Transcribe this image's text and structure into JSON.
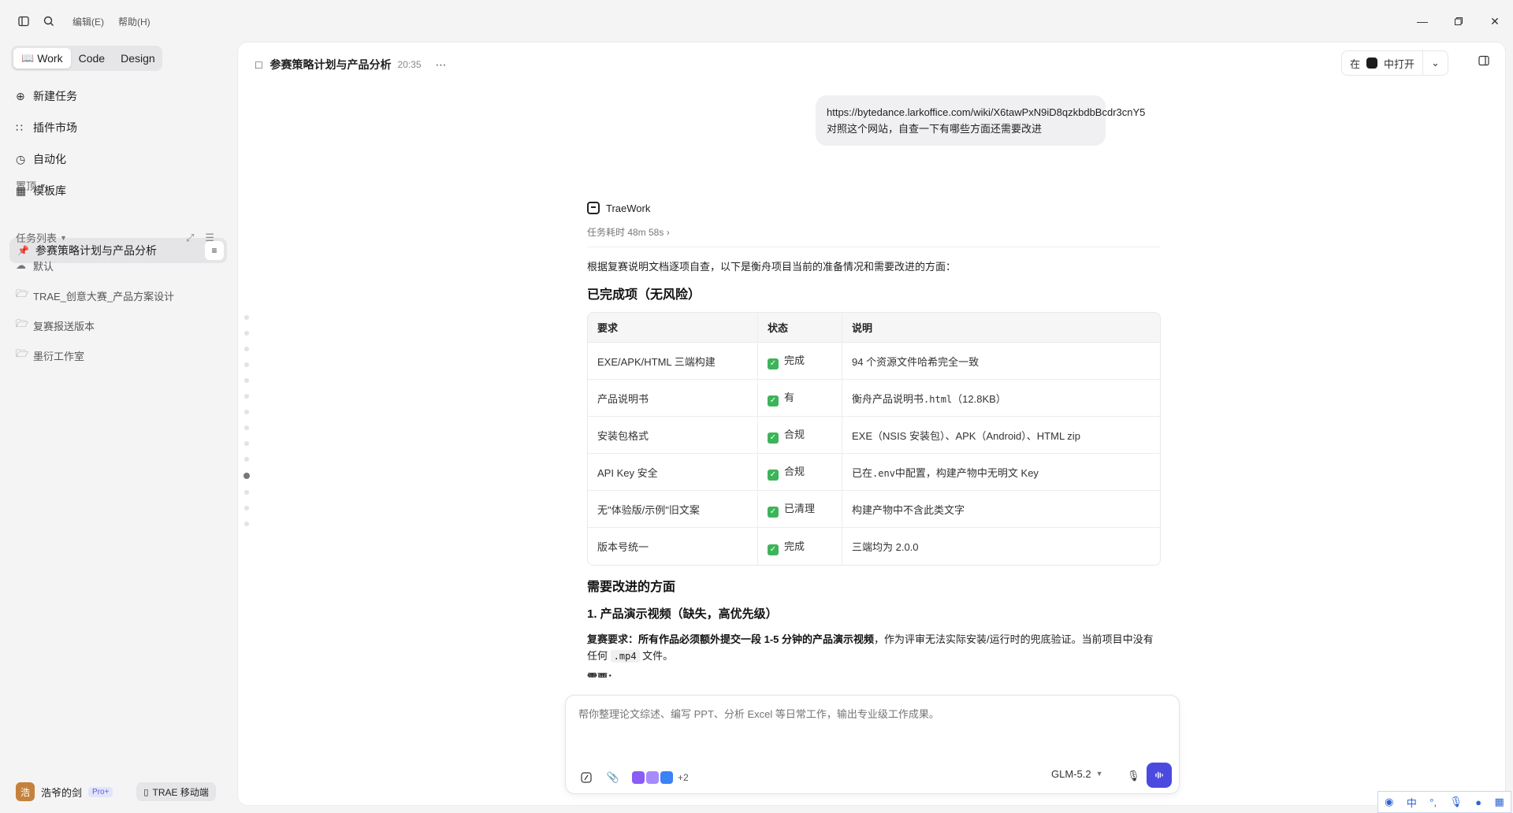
{
  "titlebar": {
    "menu": [
      "编辑(E)",
      "帮助(H)"
    ]
  },
  "sidebar": {
    "modes": [
      "Work",
      "Code",
      "Design"
    ],
    "nav": [
      "新建任务",
      "插件市场",
      "自动化",
      "模板库"
    ],
    "pinned_label": "置顶",
    "pinned_item": "参赛策略计划与产品分析",
    "tasks_label": "任务列表",
    "folders": [
      "默认",
      "TRAE_创意大赛_产品方案设计",
      "复赛报送版本",
      "墨衍工作室"
    ],
    "user": {
      "name": "浩爷的剑",
      "badge": "Pro+",
      "avatar_char": "浩"
    },
    "mobile_label": "TRAE 移动端"
  },
  "header": {
    "title": "参赛策略计划与产品分析",
    "time": "20:35",
    "open_in_prefix": "在",
    "open_in_suffix": "中打开"
  },
  "conversation": {
    "user_message_line1": "https://bytedance.larkoffice.com/wiki/X6tawPxN9iD8qzkbdbBcdr3cnY5",
    "user_message_line2": "对照这个网站，自查一下有哪些方面还需要改进",
    "assistant_name": "TraeWork",
    "duration": "任务耗时 48m 58s",
    "intro": "根据复赛说明文档逐项自查，以下是衡舟项目当前的准备情况和需要改进的方面：",
    "done_heading": "已完成项（无风险）",
    "table_headers": [
      "要求",
      "状态",
      "说明"
    ],
    "rows": [
      {
        "req": "EXE/APK/HTML 三端构建",
        "status": "完成",
        "note_pre": "94 个资源文件哈希完全一致",
        "code": "",
        "note_post": ""
      },
      {
        "req": "产品说明书",
        "status": "有",
        "note_pre": "衡舟产品说明书",
        "code": ".html",
        "note_post": "（12.8KB）"
      },
      {
        "req": "安装包格式",
        "status": "合规",
        "note_pre": "EXE（NSIS 安装包）、APK（Android）、HTML zip",
        "code": "",
        "note_post": ""
      },
      {
        "req": "API Key 安全",
        "status": "合规",
        "note_pre": "已在",
        "code": ".env",
        "note_post": "中配置，构建产物中无明文 Key"
      },
      {
        "req": "无\"体验版/示例\"旧文案",
        "status": "已清理",
        "note_pre": "构建产物中不含此类文字",
        "code": "",
        "note_post": ""
      },
      {
        "req": "版本号统一",
        "status": "完成",
        "note_pre": "三端均为 2.0.0",
        "code": "",
        "note_post": ""
      }
    ],
    "improve_heading": "需要改进的方面",
    "item1_heading": "1. 产品演示视频（缺失，高优先级）",
    "item1_label": "复赛要求：",
    "item1_bold": "所有作品必须额外提交一段 1-5 分钟的产品演示视频",
    "item1_rest": "，作为评审无法实际安装/运行时的兜底验证。当前项目中没有任何",
    "item1_code": ".mp4",
    "item1_end": "文件。",
    "cutoff_text": "需要："
  },
  "composer": {
    "placeholder": "帮你整理论文综述、编写 PPT、分析 Excel 等日常工作，输出专业级工作成果。",
    "extra_count": "+2",
    "model": "GLM-5.2"
  },
  "ime": {
    "lang": "中"
  },
  "colors": {
    "accent": "#4b4ae0",
    "check": "#3db35a",
    "pro_badge": "#5b5fd6"
  }
}
